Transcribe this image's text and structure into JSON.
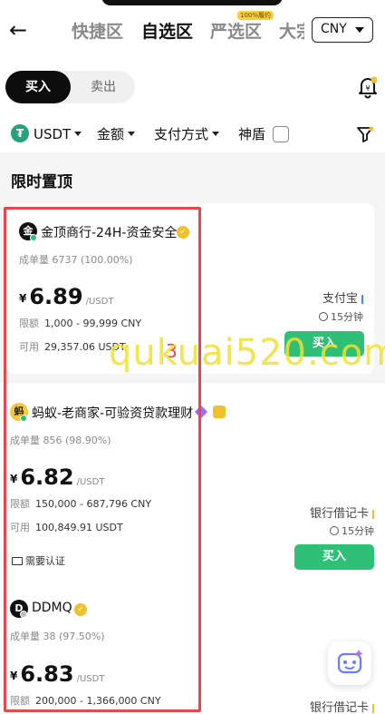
{
  "header": {
    "back": "←",
    "tabs": [
      "快捷区",
      "自选区",
      "严选区",
      "大宗"
    ],
    "tab_badge": "100%履约",
    "currency": "CNY"
  },
  "toggle": {
    "buy": "买入",
    "sell": "卖出"
  },
  "filters": {
    "coin": "USDT",
    "coin_icon": "₮",
    "amount": "金额",
    "payment": "支付方式",
    "shield": "神盾"
  },
  "section_title": "限时置顶",
  "labels": {
    "volume": "成单量",
    "limit": "限额",
    "available": "可用",
    "unit": "/USDT",
    "yen": "¥",
    "buy": "买入"
  },
  "ads": [
    {
      "avatar": "金",
      "name": "金顶商行-24H-资金安全",
      "volume": "6737 (100.00%)",
      "price": "6.89",
      "limit": "1,000 - 99,999 CNY",
      "available": "29,357.06 USDT",
      "payment": "支付宝",
      "timer": "15分钟",
      "pay_color": "#3b8ef0"
    },
    {
      "avatar": "蚂",
      "name": "蚂蚁-老商家-可验资贷款理财",
      "volume": "856 (98.90%)",
      "price": "6.82",
      "limit": "150,000 - 687,796 CNY",
      "available": "100,849.91 USDT",
      "payment": "银行借记卡",
      "timer": "15分钟",
      "verify": "需要认证",
      "pay_color": "#f1c12b"
    },
    {
      "avatar": "D",
      "name": "DDMQ",
      "volume": "38 (97.50%)",
      "price": "6.83",
      "limit": "200,000 - 1,366,000 CNY",
      "payment": "银行借记卡",
      "pay_color": "#f1c12b"
    }
  ],
  "annotation": "3",
  "watermark": "qukuai520.com"
}
